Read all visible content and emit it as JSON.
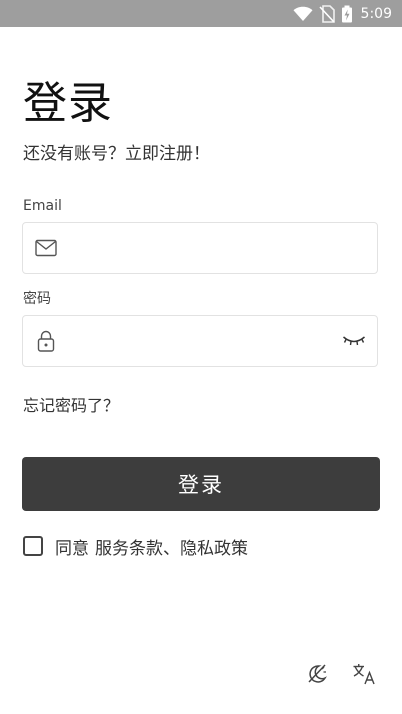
{
  "status_bar": {
    "time": "5:09",
    "icons": [
      "wifi-icon",
      "no-sim-icon",
      "battery-charging-icon"
    ]
  },
  "login": {
    "title": "登录",
    "register_prompt": "还没有账号？立即注册！",
    "email_label": "Email",
    "email_value": "",
    "email_icon": "mail-icon",
    "password_label": "密码",
    "password_value": "",
    "password_icon": "lock-icon",
    "password_toggle_icon": "eye-closed-icon",
    "forgot_password": "忘记密码了？",
    "submit_label": "登录",
    "agree_prefix": "同意",
    "agree_terms": "服务条款、隐私政策",
    "agree_checked": false
  },
  "bottom_bar": {
    "icons": [
      "theme-toggle-icon",
      "translate-icon"
    ]
  },
  "colors": {
    "status_bar": "#9e9e9e",
    "primary_button": "#3d3d3d",
    "field_border": "#e2e2e2",
    "text": "#333333"
  }
}
